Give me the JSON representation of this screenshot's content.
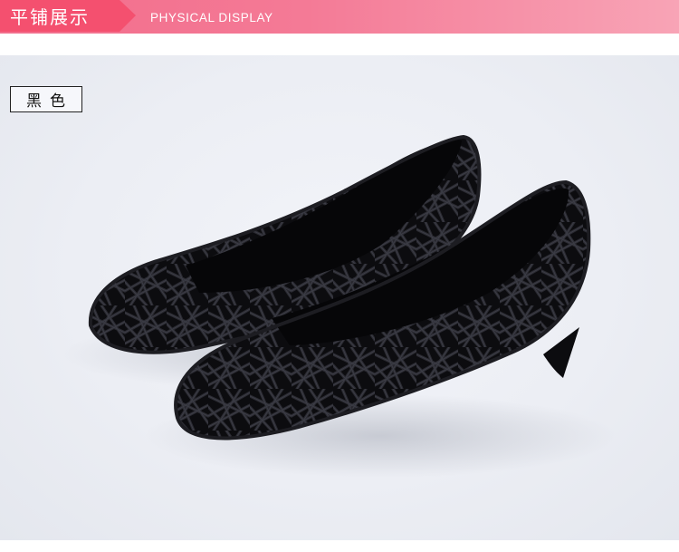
{
  "header": {
    "title_cn": "平铺展示",
    "title_en": "PHYSICAL DISPLAY"
  },
  "product": {
    "color_label": "黑色"
  },
  "colors": {
    "header_accent": "#f4506f",
    "header_band": "#f47a96",
    "shoe": "#151518"
  }
}
